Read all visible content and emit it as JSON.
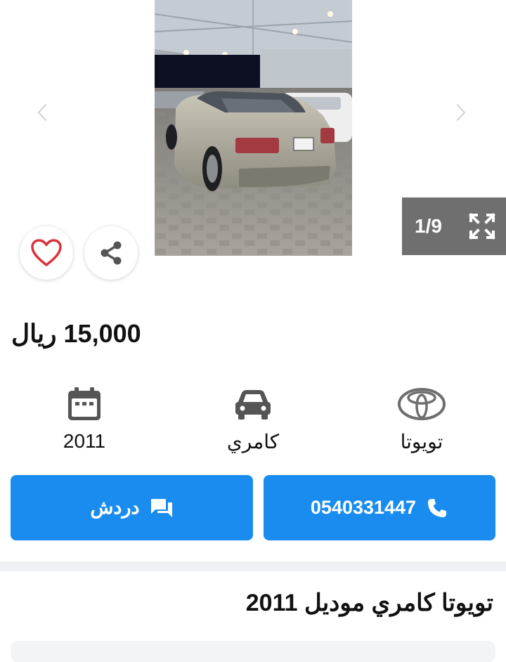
{
  "gallery": {
    "counter": "1/9",
    "icons": {
      "prev": "chevron-left-icon",
      "next": "chevron-right-icon",
      "expand": "expand-icon",
      "favorite": "heart-icon",
      "share": "share-icon"
    }
  },
  "listing": {
    "price_amount": "15,000",
    "price_currency": "ريال",
    "title": "تويوتا كامري موديل 2011"
  },
  "specs": {
    "make": "تويوتا",
    "model": "كامري",
    "year": "2011"
  },
  "actions": {
    "call_label": "0540331447",
    "chat_label": "دردش"
  },
  "colors": {
    "accent": "#1a8cef",
    "favorite": "#d9333a",
    "counter_bg": "#6f6f6f",
    "icon_gray": "#555555"
  }
}
